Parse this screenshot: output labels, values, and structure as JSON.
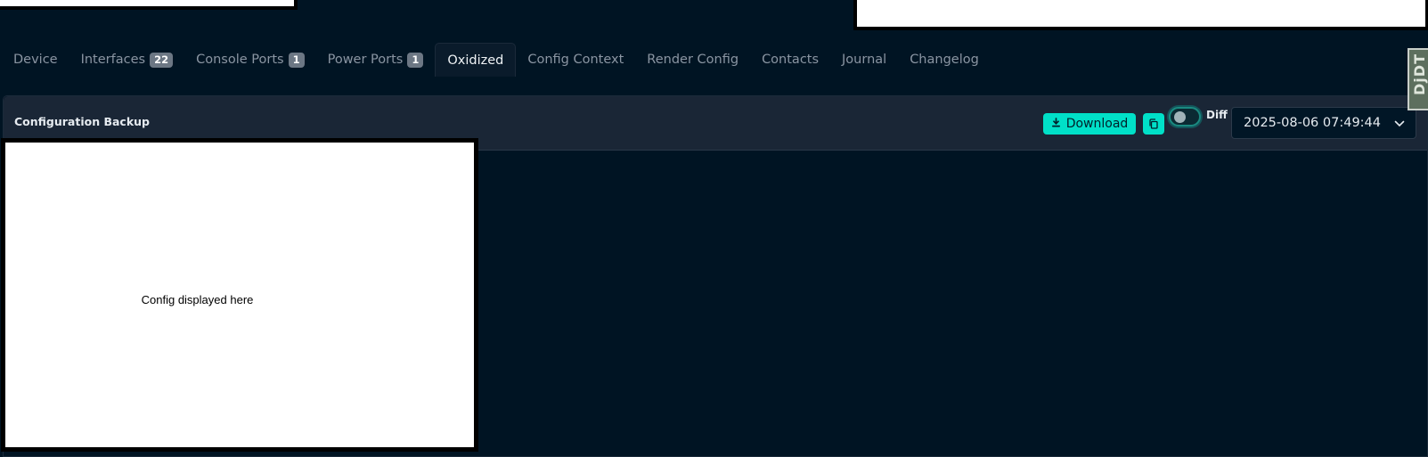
{
  "tabs": [
    {
      "label": "Device"
    },
    {
      "label": "Interfaces",
      "badge": "22"
    },
    {
      "label": "Console Ports",
      "badge": "1"
    },
    {
      "label": "Power Ports",
      "badge": "1"
    },
    {
      "label": "Oxidized",
      "active": true
    },
    {
      "label": "Config Context"
    },
    {
      "label": "Render Config"
    },
    {
      "label": "Contacts"
    },
    {
      "label": "Journal"
    },
    {
      "label": "Changelog"
    }
  ],
  "card": {
    "title": "Configuration Backup",
    "download_label": "Download",
    "diff_label": "Diff",
    "diff_enabled": false,
    "selected_backup": "2025-08-06 07:49:44",
    "placeholder_text": "Config displayed here"
  },
  "debug_toolbar": {
    "label": "DjDT"
  },
  "colors": {
    "accent": "#00e0c8",
    "background": "#001423",
    "card_header": "#1a2636"
  },
  "icons": {
    "download": "download-icon",
    "copy": "copy-icon",
    "dropdown": "chevron-down-icon"
  }
}
